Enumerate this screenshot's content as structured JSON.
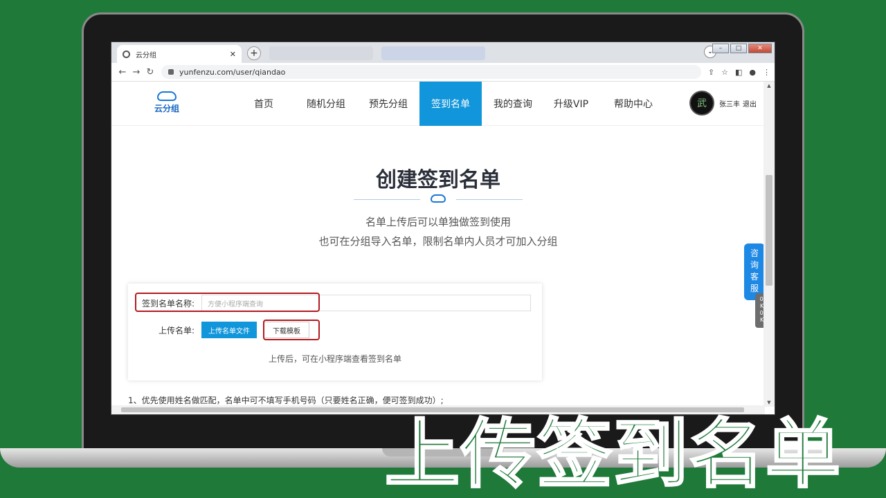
{
  "browser": {
    "tab_title": "云分组",
    "url": "yunfenzu.com/user/qiandao"
  },
  "site": {
    "logo_text": "云分组",
    "nav": [
      "首页",
      "随机分组",
      "预先分组",
      "签到名单",
      "我的查询",
      "升级VIP",
      "帮助中心"
    ],
    "active_nav": "签到名单",
    "user_name": "张三丰",
    "logout": "退出",
    "avatar_char": "武"
  },
  "hero": {
    "title": "创建签到名单",
    "sub1": "名单上传后可以单独做签到使用",
    "sub2": "也可在分组导入名单，限制名单内人员才可加入分组"
  },
  "form": {
    "name_label": "签到名单名称:",
    "name_placeholder": "方便小程序端查询",
    "upload_label": "上传名单:",
    "upload_button": "上传名单文件",
    "download_button": "下载模板",
    "hint": "上传后，可在小程序端查看签到名单"
  },
  "note": "1、优先使用姓名做匹配，名单中可不填写手机号码（只要姓名正确，便可签到成功）;",
  "side_widget": "咨询客服",
  "speed": [
    "0.7",
    "K/s",
    "0.7",
    "K/s"
  ],
  "overlay_title": "上传签到名单",
  "colors": {
    "accent": "#1296db",
    "highlight": "#b3191d",
    "background": "#1f7a3a"
  }
}
